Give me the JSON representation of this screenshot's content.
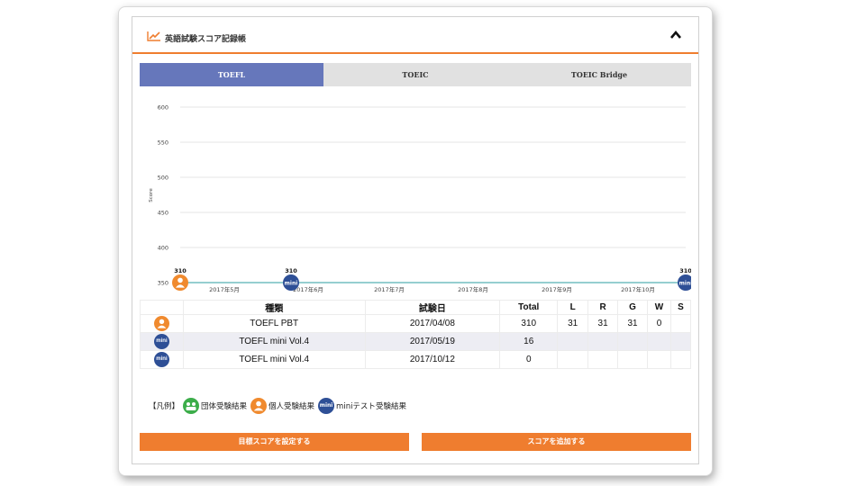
{
  "header": {
    "title": "英語試験スコア記録帳"
  },
  "tabs": [
    {
      "label": "TOEFL",
      "active": true
    },
    {
      "label": "TOEIC",
      "active": false
    },
    {
      "label": "TOEIC Bridge",
      "active": false
    }
  ],
  "chart_data": {
    "type": "line",
    "ylabel": "Score",
    "ylim": [
      350,
      600
    ],
    "yticks": [
      600,
      550,
      500,
      450,
      400,
      350
    ],
    "x_tick_labels": [
      "2017年5月",
      "2017年6月",
      "2017年7月",
      "2017年8月",
      "2017年9月",
      "2017年10月"
    ],
    "x_tick_dates": [
      "2017-05-01",
      "2017-06-01",
      "2017-07-01",
      "2017-08-01",
      "2017-09-01",
      "2017-10-01"
    ],
    "xlim": [
      "2017-04-08",
      "2017-10-12"
    ],
    "grid": true,
    "points": [
      {
        "date": "2017-04-08",
        "value": 310,
        "marker": "person",
        "label": "310"
      },
      {
        "date": "2017-05-19",
        "value": 310,
        "marker": "mini",
        "label": "310"
      },
      {
        "date": "2017-10-12",
        "value": 310,
        "marker": "mini",
        "label": "310"
      }
    ],
    "colors": {
      "line": "#56b0b4",
      "grid": "#e6e6e6",
      "person": "#f08a2e",
      "mini": "#2e4f96",
      "group": "#3cad4a"
    }
  },
  "icons": {
    "mini_text": "mini"
  },
  "table": {
    "headers": [
      "",
      "種類",
      "試験日",
      "Total",
      "L",
      "R",
      "G",
      "W",
      "S"
    ],
    "rows": [
      {
        "icon": "person",
        "type": "TOEFL PBT",
        "date": "2017/04/08",
        "total": "310",
        "L": "31",
        "R": "31",
        "G": "31",
        "W": "0",
        "S": ""
      },
      {
        "icon": "mini",
        "type": "TOEFL mini Vol.4",
        "date": "2017/05/19",
        "total": "16",
        "L": "",
        "R": "",
        "G": "",
        "W": "",
        "S": ""
      },
      {
        "icon": "mini",
        "type": "TOEFL mini Vol.4",
        "date": "2017/10/12",
        "total": "0",
        "L": "",
        "R": "",
        "G": "",
        "W": "",
        "S": ""
      }
    ]
  },
  "legend": {
    "label": "【凡例】",
    "group": "団体受験結果",
    "person": "個人受験結果",
    "mini": "miniテスト受験結果"
  },
  "buttons": {
    "set_target": "目標スコアを設定する",
    "add_score": "スコアを追加する"
  },
  "colors": {
    "accent": "#ef7d2f",
    "tab_active": "#6677bb",
    "tab_inactive": "#e1e1e1"
  }
}
